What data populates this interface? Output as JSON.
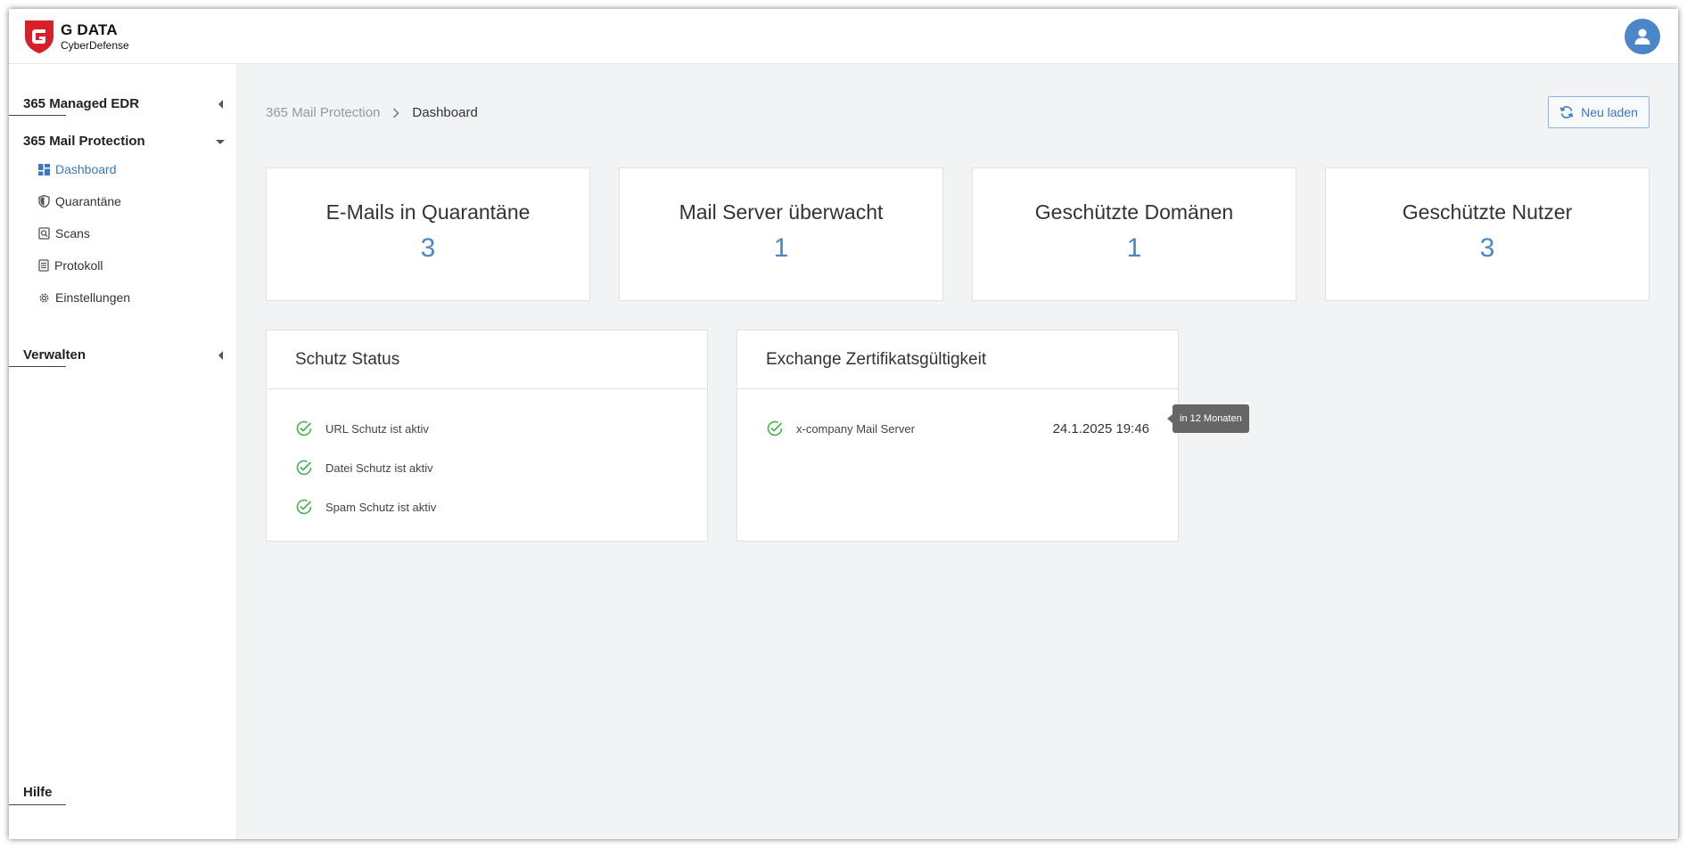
{
  "header": {
    "brand": "G DATA",
    "brand_sub": "CyberDefense",
    "avatar_icon": "user-icon"
  },
  "sidebar": {
    "groups": [
      {
        "label": "365 Managed EDR",
        "expanded": false
      },
      {
        "label": "365 Mail Protection",
        "expanded": true
      },
      {
        "label": "Verwalten",
        "expanded": false
      }
    ],
    "items": [
      {
        "label": "Dashboard",
        "icon": "dashboard-icon",
        "active": true
      },
      {
        "label": "Quarantäne",
        "icon": "shield-icon",
        "active": false
      },
      {
        "label": "Scans",
        "icon": "scan-icon",
        "active": false
      },
      {
        "label": "Protokoll",
        "icon": "log-icon",
        "active": false
      },
      {
        "label": "Einstellungen",
        "icon": "gear-icon",
        "active": false
      }
    ],
    "help": "Hilfe"
  },
  "breadcrumb": {
    "parent": "365 Mail Protection",
    "current": "Dashboard"
  },
  "toolbar": {
    "reload_label": "Neu laden"
  },
  "stats": [
    {
      "label": "E-Mails in Quarantäne",
      "value": "3"
    },
    {
      "label": "Mail Server überwacht",
      "value": "1"
    },
    {
      "label": "Geschützte Domänen",
      "value": "1"
    },
    {
      "label": "Geschützte Nutzer",
      "value": "3"
    }
  ],
  "protection_status": {
    "title": "Schutz Status",
    "items": [
      {
        "label": "URL Schutz ist aktiv",
        "status": "ok"
      },
      {
        "label": "Datei Schutz ist aktiv",
        "status": "ok"
      },
      {
        "label": "Spam Schutz ist aktiv",
        "status": "ok"
      }
    ]
  },
  "certificate": {
    "title": "Exchange Zertifikatsgültigkeit",
    "items": [
      {
        "server": "x-company Mail Server",
        "date": "24.1.2025 19:46",
        "tooltip": "in 12 Monaten",
        "status": "ok"
      }
    ]
  },
  "colors": {
    "accent": "#4a86c8",
    "success": "#4caf50",
    "brand_red": "#d8202a"
  }
}
